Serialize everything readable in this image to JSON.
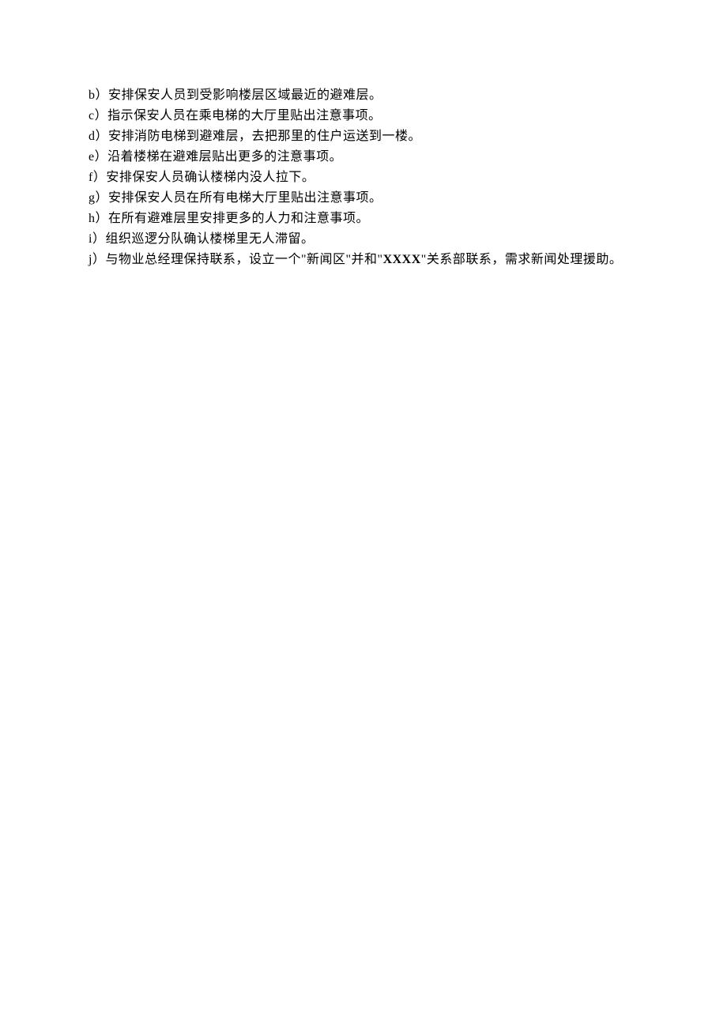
{
  "items": [
    {
      "label": "b）",
      "text": "安排保安人员到受影响楼层区域最近的避难层。"
    },
    {
      "label": "c）",
      "text": "指示保安人员在乘电梯的大厅里贴出注意事项。"
    },
    {
      "label": "d）",
      "text": "安排消防电梯到避难层，去把那里的住户运送到一楼。"
    },
    {
      "label": "e）",
      "text": "沿着楼梯在避难层贴出更多的注意事项。"
    },
    {
      "label": "f）",
      "text": "安排保安人员确认楼梯内没人拉下。"
    },
    {
      "label": "g）",
      "text": "安排保安人员在所有电梯大厅里贴出注意事项。"
    },
    {
      "label": "h）",
      "text": "在所有避难层里安排更多的人力和注意事项。"
    },
    {
      "label": "i）",
      "text": "组织巡逻分队确认楼梯里无人滞留。"
    }
  ],
  "lastItem": {
    "label": "j）",
    "part1": "与物业总经理保持联系，设立一个\"新闻区\"并和\"",
    "bold": "XXXX",
    "part2": "\"关系部联系，需求新闻处理援助。"
  }
}
